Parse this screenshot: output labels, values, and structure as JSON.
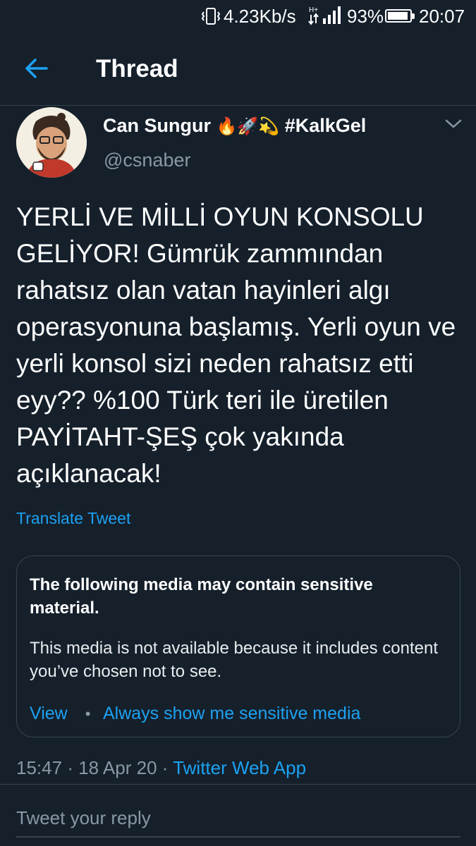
{
  "status_bar": {
    "net_speed": "4.23Kb/s",
    "network_type": "H+",
    "battery_percent": "93%",
    "battery_level": 0.93,
    "time": "20:07",
    "icons": [
      "vibrate-icon",
      "signal-icon",
      "battery-icon"
    ]
  },
  "header": {
    "title": "Thread",
    "back_icon": "arrow-left-icon"
  },
  "tweet": {
    "author": {
      "name": "Can Sungur",
      "name_emojis": "🔥🚀💫",
      "hashtag": "#KalkGel",
      "handle": "@csnaber"
    },
    "text": "YERLİ VE MİLLİ OYUN KONSOLU GELİYOR! Gümrük zammından rahatsız olan vatan hayinleri algı operasyonuna başlamış. Yerli oyun ve yerli konsol sizi neden rahatsız etti eyy?? %100 Türk teri ile üretilen PAYİTAHT-ŞEŞ çok yakında açıklanacak!",
    "translate_label": "Translate Tweet",
    "sensitive_card": {
      "title": "The following media may contain sensitive material.",
      "body": "This media is not available because it includes content you’ve chosen not to see.",
      "view_label": "View",
      "separator": "•",
      "always_show_label": "Always show me sensitive media"
    },
    "meta": {
      "time": "15:47",
      "separator": "·",
      "date": "18 Apr 20",
      "source": "Twitter Web App"
    }
  },
  "reply": {
    "placeholder": "Tweet your reply"
  },
  "colors": {
    "background": "#15202b",
    "accent": "#1da1f2",
    "secondary_text": "#8899a6",
    "border": "#38444d"
  }
}
